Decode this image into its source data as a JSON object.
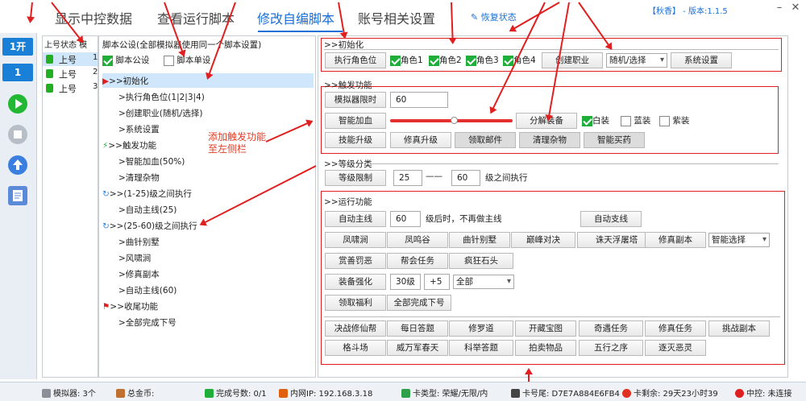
{
  "header": {
    "tabs": [
      "显示中控数据",
      "查看运行脚本",
      "修改自编脚本",
      "账号相关设置"
    ],
    "restore_label": "恢复状态",
    "version": "【秋香】 - 版本:1.1.5"
  },
  "sidebar": {
    "btn_open": "1开",
    "btn_one": "1"
  },
  "accounts": {
    "headers": "上号状态  模",
    "rows": [
      {
        "status": "上号",
        "num": "1"
      },
      {
        "status": "上号",
        "num": "2"
      },
      {
        "status": "上号",
        "num": "3"
      }
    ]
  },
  "script_tree": {
    "title": "脚本公设(全部模拟器使用同一个脚本设置)",
    "public_label": "脚本公设",
    "single_label": "脚本单设",
    "nodes": [
      ">>初始化",
      ">执行角色位(1|2|3|4)",
      ">创建职业(随机/选择)",
      ">系统设置",
      ">>触发功能",
      ">智能加血(50%)",
      ">清理杂物",
      ">>(1-25)级之间执行",
      ">自动主线(25)",
      ">>(25-60)级之间执行",
      ">曲针别墅",
      ">风啸涧",
      ">修真副本",
      ">自动主线(60)",
      ">>收尾功能",
      ">全部完成下号"
    ],
    "annotation": "添加触发功能至左侧栏"
  },
  "init_group": {
    "title": ">>初始化",
    "exec_role_btn": "执行角色位",
    "roles": [
      "角色1",
      "角色2",
      "角色3",
      "角色4"
    ],
    "create_job_btn": "创建职业",
    "job_select": "随机/选择",
    "system_btn": "系统设置"
  },
  "trigger_group": {
    "title": ">>触发功能",
    "emu_limit_btn": "模拟器限时",
    "emu_limit_value": "60",
    "heal_btn": "智能加血",
    "heal_level": 0.52,
    "decompose_btn": "分解装备",
    "white_label": "白装",
    "blue_label": "蓝装",
    "purple_label": "紫装",
    "buttons": [
      "技能升级",
      "修真升级",
      "领取邮件",
      "清理杂物",
      "智能买药"
    ]
  },
  "level_group": {
    "title": ">>等级分类",
    "limit_btn": "等级限制",
    "from": "25",
    "dash": "——",
    "to": "60",
    "suffix": "级之间执行"
  },
  "run_group": {
    "title": ">>运行功能",
    "auto_main_btn": "自动主线",
    "auto_main_value": "60",
    "auto_main_note": "级后时，不再做主线",
    "auto_branch_btn": "自动支线",
    "row2": [
      "凤啸涧",
      "凤鸣谷",
      "曲针别墅",
      "巅峰对决",
      "诛天浮屠塔",
      "修真副本"
    ],
    "smart_select": "智能选择",
    "row3": [
      "赏善罚恶",
      "帮会任务",
      "疯狂石头"
    ],
    "enhance_btn": "装备强化",
    "enhance_level": "30级",
    "enhance_plus": "+5",
    "enhance_select": "全部",
    "welfare_btn": "领取福利",
    "finish_btn": "全部完成下号",
    "row6": [
      "决战修仙帮",
      "每日答题",
      "修罗道",
      "开藏宝图",
      "奇遇任务",
      "修真任务",
      "挑战副本"
    ],
    "row7": [
      "格斗场",
      "威万军春天",
      "科举答题",
      "拍卖物品",
      "五行之序",
      "逐灭恶灵"
    ]
  },
  "status_bar": {
    "emulator": "模拟器: 3个",
    "gold": "总金币:",
    "done": "完成号数: 0/1",
    "ip": "内网IP: 192.168.3.18",
    "card_type": "卡类型: 荣耀/无限/内",
    "card_tail": "卡号尾: D7E7A884E6FB4",
    "card_left": "卡剩余: 29天23小时39",
    "central": "中控: 未连接"
  },
  "colors": {
    "accent": "#1a6fd6",
    "group_border": "#e02020",
    "check_green": "#1fae3a"
  }
}
